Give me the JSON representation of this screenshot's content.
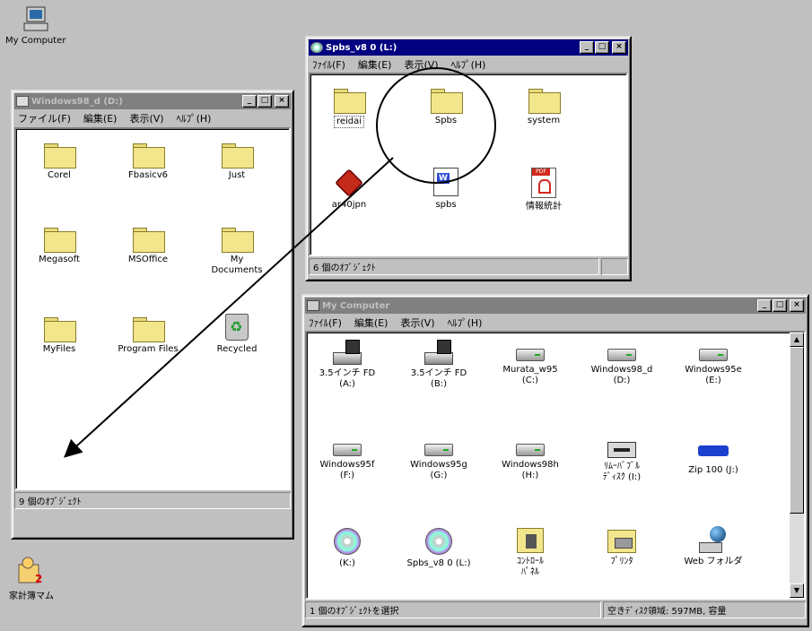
{
  "desktop": {
    "my_computer_label": "My Computer",
    "kakeibo_label": "家計簿マム"
  },
  "win_d": {
    "title": "Windows98_d (D:)",
    "menu": [
      "ファイル(F)",
      "編集(E)",
      "表示(V)",
      "ﾍﾙﾌﾟ(H)"
    ],
    "items": [
      {
        "label": "Corel",
        "icon": "folder-icon"
      },
      {
        "label": "Fbasicv6",
        "icon": "folder-icon"
      },
      {
        "label": "Just",
        "icon": "folder-icon"
      },
      {
        "label": "Megasoft",
        "icon": "folder-icon"
      },
      {
        "label": "MSOffice",
        "icon": "folder-icon"
      },
      {
        "label": "My\nDocuments",
        "icon": "folder-icon"
      },
      {
        "label": "MyFiles",
        "icon": "folder-icon"
      },
      {
        "label": "Program Files",
        "icon": "folder-icon"
      },
      {
        "label": "Recycled",
        "icon": "recycle-bin-icon"
      }
    ],
    "status": "9 個のｵﾌﾞｼﾞｪｸﾄ"
  },
  "win_spbs": {
    "title": "Spbs_v8 0 (L:)",
    "menu": [
      "ﾌｧｲﾙ(F)",
      "編集(E)",
      "表示(V)",
      "ﾍﾙﾌﾟ(H)"
    ],
    "items": [
      {
        "label": "reidai",
        "icon": "folder-icon"
      },
      {
        "label": "Spbs",
        "icon": "folder-icon"
      },
      {
        "label": "system",
        "icon": "folder-icon"
      },
      {
        "label": "ar40jpn",
        "icon": "installer-icon"
      },
      {
        "label": "spbs",
        "icon": "word-document-icon"
      },
      {
        "label": "情報統計",
        "icon": "pdf-icon"
      }
    ],
    "status": "6 個のｵﾌﾞｼﾞｪｸﾄ"
  },
  "win_mycomp": {
    "title": "My Computer",
    "menu": [
      "ﾌｧｲﾙ(F)",
      "編集(E)",
      "表示(V)",
      "ﾍﾙﾌﾟ(H)"
    ],
    "items": [
      {
        "label": "3.5インチ FD\n(A:)",
        "icon": "floppy-drive-icon"
      },
      {
        "label": "3.5インチ FD\n(B:)",
        "icon": "floppy-drive-icon"
      },
      {
        "label": "Murata_w95\n(C:)",
        "icon": "hard-drive-icon"
      },
      {
        "label": "Windows98_d\n(D:)",
        "icon": "hard-drive-icon"
      },
      {
        "label": "Windows95e\n(E:)",
        "icon": "hard-drive-icon"
      },
      {
        "label": "Windows95f\n(F:)",
        "icon": "hard-drive-icon"
      },
      {
        "label": "Windows95g\n(G:)",
        "icon": "hard-drive-icon"
      },
      {
        "label": "Windows98h\n(H:)",
        "icon": "hard-drive-icon"
      },
      {
        "label": "ﾘﾑｰﾊﾞﾌﾞﾙ\nﾃﾞｨｽｸ (I:)",
        "icon": "removable-disk-icon"
      },
      {
        "label": "Zip 100 (J:)",
        "icon": "zip-drive-icon"
      },
      {
        "label": "(K:)",
        "icon": "cd-drive-icon"
      },
      {
        "label": "Spbs_v8 0 (L:)",
        "icon": "cd-drive-icon"
      },
      {
        "label": "ｺﾝﾄﾛｰﾙ\nﾊﾟﾈﾙ",
        "icon": "control-panel-icon"
      },
      {
        "label": "ﾌﾟﾘﾝﾀ",
        "icon": "printers-icon"
      },
      {
        "label": "Web フォルダ",
        "icon": "web-folder-icon"
      }
    ],
    "status_left": "1 個のｵﾌﾞｼﾞｪｸﾄを選択",
    "status_right": "空きﾃﾞｨｽｸ領域: 597MB, 容量"
  },
  "tb_buttons": {
    "minimize": "_",
    "maximize": "□",
    "close": "×"
  },
  "scroll_glyphs": {
    "up": "▲",
    "down": "▼"
  }
}
